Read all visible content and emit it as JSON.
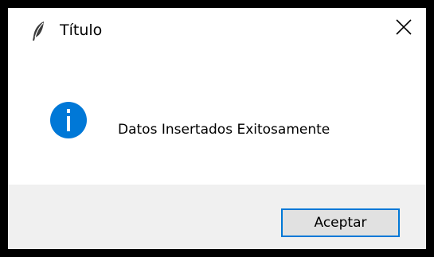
{
  "window": {
    "title": "Título",
    "app_icon": "feather-icon",
    "close_icon": "close-icon"
  },
  "message": {
    "icon": "info-icon",
    "icon_color": "#0078d7",
    "text": "Datos Insertados Exitosamente"
  },
  "footer": {
    "ok_label": "Aceptar",
    "focus_color": "#0078d7"
  }
}
